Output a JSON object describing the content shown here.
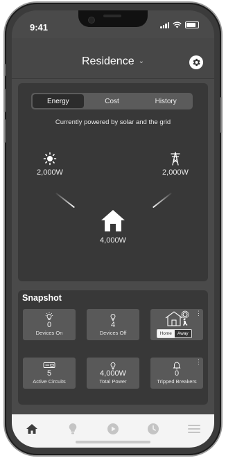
{
  "status_bar": {
    "time": "9:41"
  },
  "header": {
    "title": "Residence",
    "dropdown_icon": "chevron-down-icon",
    "settings_icon": "gear-icon"
  },
  "energy": {
    "tabs": [
      {
        "label": "Energy",
        "active": true
      },
      {
        "label": "Cost",
        "active": false
      },
      {
        "label": "History",
        "active": false
      }
    ],
    "note": "Currently powered by solar and the grid",
    "solar": {
      "icon": "sun-icon",
      "value": "2,000W"
    },
    "grid": {
      "icon": "power-tower-icon",
      "value": "2,000W"
    },
    "home": {
      "icon": "home-icon",
      "value": "4,000W"
    }
  },
  "snapshot": {
    "title": "Snapshot",
    "tiles": [
      {
        "icon": "bulb-on-icon",
        "value": "0",
        "label": "Devices On"
      },
      {
        "icon": "bulb-off-icon",
        "value": "4",
        "label": "Devices Off"
      },
      {
        "icon": "home-away-icon",
        "toggle": {
          "home": "Home",
          "away": "Away",
          "selected": "Away"
        }
      },
      {
        "icon": "breaker-panel-icon",
        "value": "5",
        "label": "Active Circuits"
      },
      {
        "icon": "bulb-icon",
        "value": "4,000W",
        "label": "Total Power"
      },
      {
        "icon": "bell-icon",
        "value": "0",
        "label": "Tripped Breakers"
      }
    ]
  },
  "nav": [
    "home-icon",
    "bulb-icon",
    "play-icon",
    "clock-icon",
    "menu-icon"
  ],
  "colors": {
    "background": "#4a4a4a",
    "card": "#383838",
    "tile": "#595959",
    "nav_background": "#f4f4f4"
  }
}
